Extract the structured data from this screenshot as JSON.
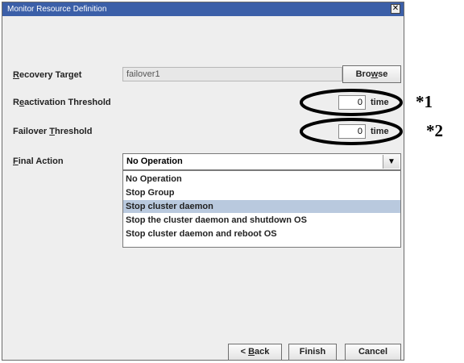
{
  "window": {
    "title": "Monitor Resource Definition",
    "close_glyph": "✕"
  },
  "form": {
    "recovery_target": {
      "label_underline": "R",
      "label_rest": "ecovery Target",
      "value": "failover1",
      "browse_pre": "Bro",
      "browse_u": "w",
      "browse_post": "se"
    },
    "reactivation": {
      "label_pre": "R",
      "label_u": "e",
      "label_post": "activation Threshold",
      "value": "0",
      "unit": "time"
    },
    "failover": {
      "label_pre": "Failover ",
      "label_u": "T",
      "label_post": "hreshold",
      "value": "0",
      "unit": "time"
    },
    "final_action": {
      "label_u": "F",
      "label_post": "inal Action",
      "selected": "No Operation",
      "options": [
        "No Operation",
        "Stop Group",
        "Stop cluster daemon",
        "Stop the cluster daemon and shutdown OS",
        "Stop cluster daemon and reboot OS"
      ],
      "highlighted_index": 2
    }
  },
  "buttons": {
    "back_pre": "< ",
    "back_u": "B",
    "back_post": "ack",
    "finish": "Finish",
    "cancel": "Cancel"
  },
  "annotations": {
    "mark1": "*1",
    "mark2": "*2"
  }
}
